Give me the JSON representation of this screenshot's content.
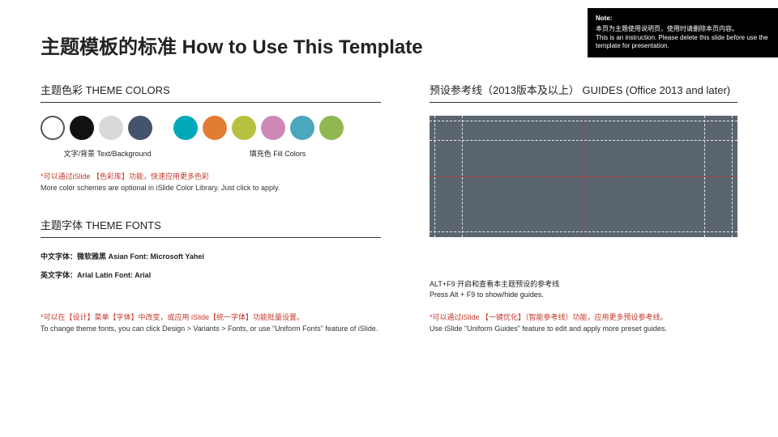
{
  "note": {
    "title": "Note:",
    "line1_cn": "本页为主题使用说明页，使用时请删除本页内容。",
    "line2_en": "This is an instruction. Please delete this slide before use the template for presentation."
  },
  "title": "主题模板的标准 How to Use This Template",
  "theme_colors": {
    "heading": "主题色彩 THEME COLORS",
    "text_bg_label": "文字/背景 Text/Background",
    "fill_label": "填充色 Fill Colors",
    "tip_cn": "*可以通过iSlide 【色彩库】功能，快速应用更多色彩",
    "tip_en": "More color schemes are optional in iSlide Color Library. Just click to apply.",
    "text_bg_swatches": [
      "#ffffff",
      "#111111",
      "#d9d9d9",
      "#44546a"
    ],
    "fill_swatches": [
      "#00a9b8",
      "#e27c35",
      "#b6c23f",
      "#cf87b8",
      "#4aa7bd",
      "#8fb850"
    ]
  },
  "theme_fonts": {
    "heading": "主题字体 THEME FONTS",
    "cn_font": "中文字体：微软雅黑  Asian Font: Microsoft Yahei",
    "en_font": "英文字体：Arial  Latin Font: Arial",
    "tip_cn": "*可以在【设计】菜单【字体】中改变，或应用 iSlide【统一字体】功能批量设置。",
    "tip_en": "To change theme fonts, you can click Design > Variants > Fonts, or use \"Uniform Fonts\" feature of iSlide."
  },
  "guides": {
    "heading": "预设参考线（2013版本及以上） GUIDES (Office 2013 and later)",
    "alt_cn": "ALT+F9 开启和查看本主题预设的参考线",
    "alt_en": "Press Alt + F9 to show/hide guides.",
    "tip_cn": "*可以通过iSlide 【一键优化】（智能参考线）功能，应用更多预设参考线。",
    "tip_en": "Use iSlide \"Uniform Guides\" feature to edit and apply more preset guides."
  }
}
